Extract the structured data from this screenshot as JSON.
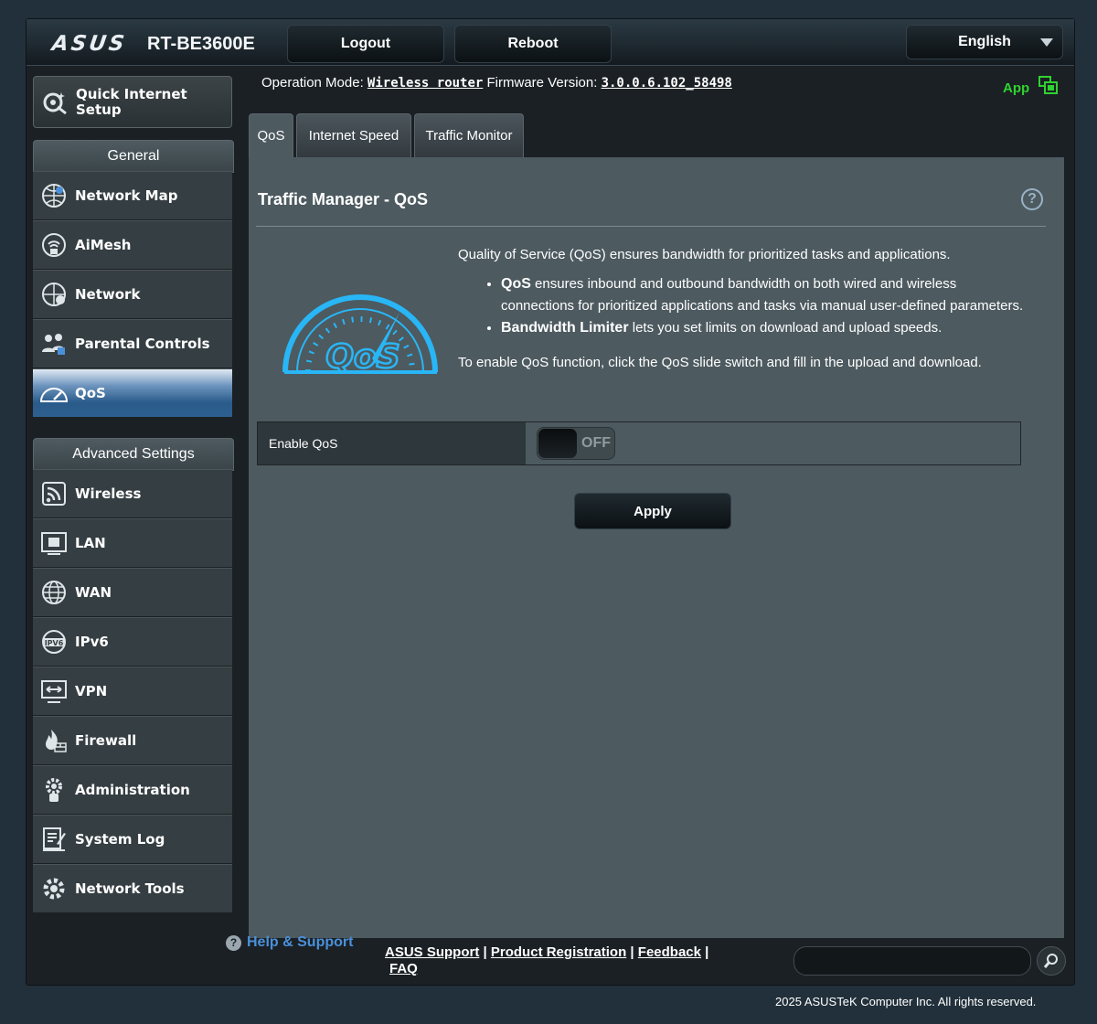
{
  "header": {
    "brand": "ASUS",
    "model": "RT-BE3600E",
    "logout_label": "Logout",
    "reboot_label": "Reboot",
    "language": "English"
  },
  "status": {
    "op_mode_label": "Operation Mode:",
    "op_mode_value": "Wireless router",
    "firmware_label": "Firmware Version:",
    "firmware_value": "3.0.0.6.102_58498",
    "app_label": "App"
  },
  "sidebar": {
    "quick_setup": "Quick Internet Setup",
    "general_header": "General",
    "general_items": [
      {
        "label": "Network Map",
        "icon": "network-map-icon"
      },
      {
        "label": "AiMesh",
        "icon": "aimesh-icon"
      },
      {
        "label": "Network",
        "icon": "network-icon"
      },
      {
        "label": "Parental Controls",
        "icon": "parental-controls-icon"
      },
      {
        "label": "QoS",
        "icon": "qos-icon"
      }
    ],
    "advanced_header": "Advanced Settings",
    "advanced_items": [
      {
        "label": "Wireless",
        "icon": "wireless-icon"
      },
      {
        "label": "LAN",
        "icon": "lan-icon"
      },
      {
        "label": "WAN",
        "icon": "wan-icon"
      },
      {
        "label": "IPv6",
        "icon": "ipv6-icon"
      },
      {
        "label": "VPN",
        "icon": "vpn-icon"
      },
      {
        "label": "Firewall",
        "icon": "firewall-icon"
      },
      {
        "label": "Administration",
        "icon": "administration-icon"
      },
      {
        "label": "System Log",
        "icon": "system-log-icon"
      },
      {
        "label": "Network Tools",
        "icon": "network-tools-icon"
      }
    ]
  },
  "tabs": [
    "QoS",
    "Internet Speed",
    "Traffic Monitor"
  ],
  "main": {
    "title": "Traffic Manager - QoS",
    "intro": "Quality of Service (QoS) ensures bandwidth for prioritized tasks and applications.",
    "bullet1_bold": "QoS",
    "bullet1_text": " ensures inbound and outbound bandwidth on both wired and wireless connections for prioritized applications and tasks via manual user-defined parameters.",
    "bullet2_bold": "Bandwidth Limiter",
    "bullet2_text": " lets you set limits on download and upload speeds.",
    "enable_hint": "To enable QoS function, click the QoS slide switch and fill in the upload and download.",
    "enable_label": "Enable QoS",
    "switch_state": "OFF",
    "apply_label": "Apply",
    "logo_text": "QoS"
  },
  "footer": {
    "help_support": "Help & Support",
    "link_asus_support": "ASUS Support",
    "link_product_registration": "Product Registration",
    "link_feedback": "Feedback",
    "link_faq": "FAQ",
    "separator": "|",
    "copyright": "2025 ASUSTeK Computer Inc. All rights reserved."
  },
  "colors": {
    "accent_green": "#2fd32f",
    "help_blue": "#4a90d9",
    "qos_blue": "#29b6f6"
  }
}
